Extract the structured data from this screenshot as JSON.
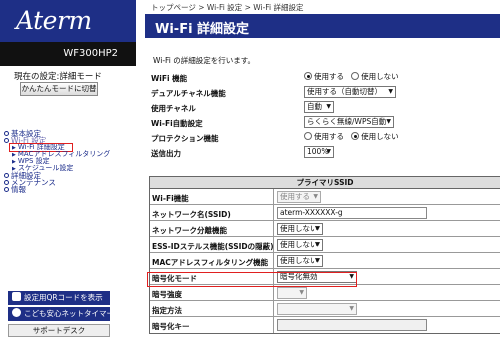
{
  "sidebar": {
    "logo": "Aterm",
    "model": "WF300HP2",
    "mode_label": "現在の設定:詳細モード",
    "mode_button": "かんたんモードに切替",
    "nav": [
      {
        "label": "基本設定",
        "level": 0
      },
      {
        "label": "Wi-Fi 設定",
        "level": 0
      },
      {
        "label": "Wi-Fi 詳細設定",
        "level": 1
      },
      {
        "label": "MACアドレスフィルタリング",
        "level": 1
      },
      {
        "label": "WPS 設定",
        "level": 1
      },
      {
        "label": "スケジュール設定",
        "level": 1
      },
      {
        "label": "詳細設定",
        "level": 0
      },
      {
        "label": "メンテナンス",
        "level": 0
      },
      {
        "label": "情報",
        "level": 0
      }
    ],
    "qr_button": "設定用QRコードを表示",
    "timer_button": "こども安心ネットタイマー",
    "support_button": "サポートデスク"
  },
  "breadcrumb": "トップページ > Wi-Fi 設定 > Wi-Fi 詳細設定",
  "page_title": "Wi-Fi 詳細設定",
  "description": "Wi-Fi の詳細設定を行います。",
  "settings": {
    "wifi_function": {
      "label": "WiFi 機能",
      "options": [
        "使用する",
        "使用しない"
      ],
      "selected": "使用する"
    },
    "dual_channel": {
      "label": "デュアルチャネル機能",
      "value": "使用する（自動切替）"
    },
    "channel": {
      "label": "使用チャネル",
      "value": "自動"
    },
    "wifi_auto": {
      "label": "Wi-Fi自動設定",
      "value": "らくらく無線/WPS自動"
    },
    "protection": {
      "label": "プロテクション機能",
      "options": [
        "使用する",
        "使用しない"
      ],
      "selected": "使用しない"
    },
    "tx_power": {
      "label": "送信出力",
      "value": "100%"
    }
  },
  "primary_ssid": {
    "header": "プライマリSSID",
    "rows": [
      {
        "label": "Wi-Fi機能",
        "value": "使用する",
        "type": "select-disabled"
      },
      {
        "label": "ネットワーク名(SSID)",
        "value": "aterm-XXXXXX-g",
        "type": "input"
      },
      {
        "label": "ネットワーク分離機能",
        "value": "使用しない",
        "type": "select"
      },
      {
        "label": "ESS-IDステルス機能(SSIDの隠蔽)",
        "value": "使用しない",
        "type": "select"
      },
      {
        "label": "MACアドレスフィルタリング機能",
        "value": "使用しない",
        "type": "select"
      },
      {
        "label": "暗号化モード",
        "value": "暗号化無効",
        "type": "select-wide"
      },
      {
        "label": "暗号強度",
        "value": "",
        "type": "select-disabled"
      },
      {
        "label": "指定方法",
        "value": "",
        "type": "select-disabled-wide"
      },
      {
        "label": "暗号化キー",
        "value": "",
        "type": "input-disabled"
      }
    ]
  }
}
